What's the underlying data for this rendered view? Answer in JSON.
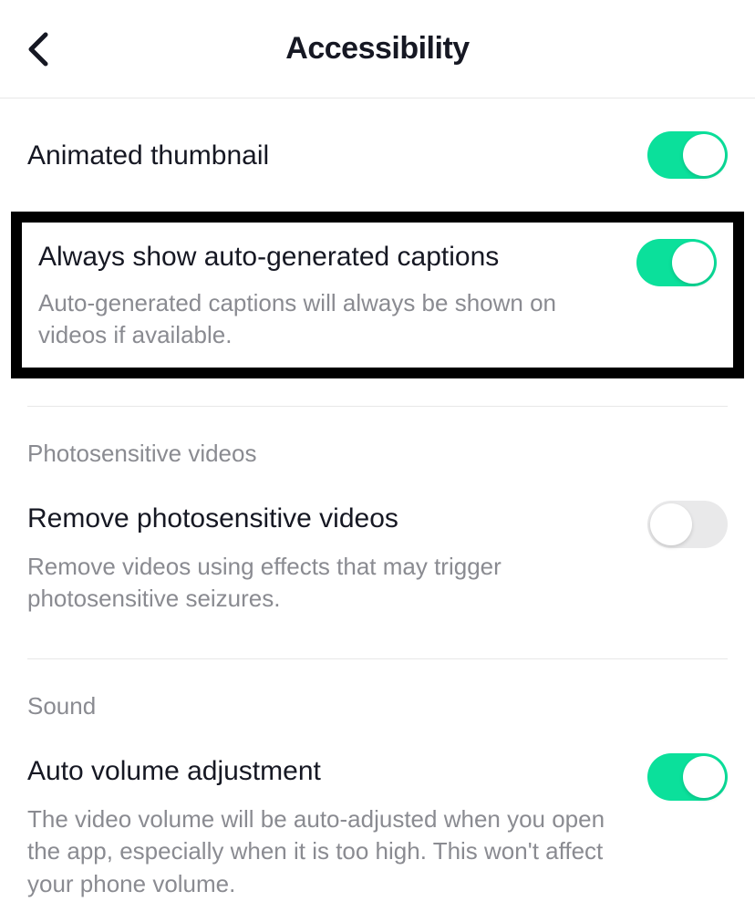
{
  "header": {
    "title": "Accessibility"
  },
  "settings": {
    "animated_thumbnail": {
      "label": "Animated thumbnail",
      "enabled": true
    },
    "auto_captions": {
      "label": "Always show auto-generated captions",
      "description": "Auto-generated captions will always be shown on videos if available.",
      "enabled": true
    },
    "photosensitive": {
      "section_title": "Photosensitive videos",
      "label": "Remove photosensitive videos",
      "description": "Remove videos using effects that may trigger photosensitive seizures.",
      "enabled": false
    },
    "sound": {
      "section_title": "Sound",
      "label": "Auto volume adjustment",
      "description": "The video volume will be auto-adjusted when you open the app, especially when it is too high. This won't affect your phone volume.",
      "enabled": true
    }
  }
}
